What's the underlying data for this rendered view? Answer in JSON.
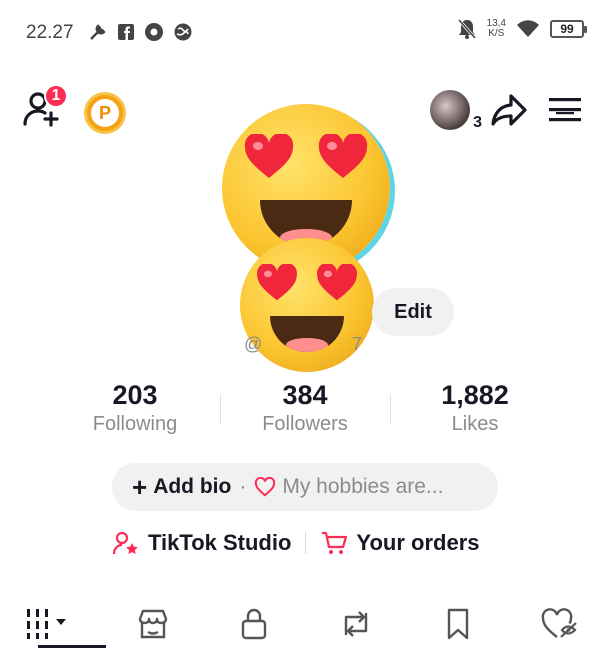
{
  "status_bar": {
    "time": "22.27",
    "left_icons": [
      "wrench-icon",
      "facebook-icon",
      "record-icon",
      "globe-icon"
    ],
    "speed_value": "13,4",
    "speed_unit": "K/S",
    "battery": "99"
  },
  "top_bar": {
    "add_friend_badge": "1",
    "points_badge": "P",
    "story_count": "3"
  },
  "profile": {
    "edit_label": "Edit",
    "username_start": "@",
    "username_end": "7"
  },
  "stats": [
    {
      "value": "203",
      "label": "Following"
    },
    {
      "value": "384",
      "label": "Followers"
    },
    {
      "value": "1,882",
      "label": "Likes"
    }
  ],
  "bio": {
    "add_label": "Add bio",
    "separator": "·",
    "hobbies_label": "My hobbies are..."
  },
  "links": {
    "studio_label": "TikTok Studio",
    "orders_label": "Your orders"
  },
  "tabs": [
    "videos-grid-icon",
    "shop-icon",
    "lock-icon",
    "repost-icon",
    "bookmark-icon",
    "liked-icon"
  ],
  "colors": {
    "accent": "#fe2c55",
    "text": "#161823",
    "muted": "#8a8b91",
    "pill_bg": "#f1f1f2",
    "points": "#f5a313"
  }
}
